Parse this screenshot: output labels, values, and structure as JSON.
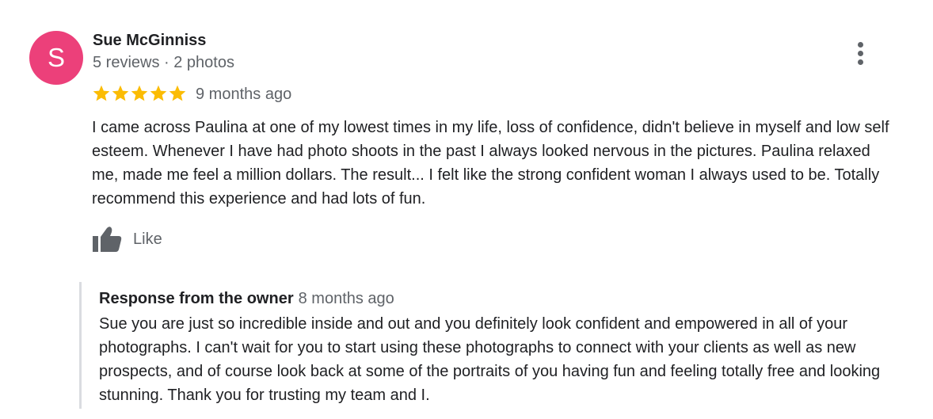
{
  "reviewer": {
    "initial": "S",
    "avatar_color": "#ec407a",
    "name": "Sue McGinniss",
    "meta": "5 reviews · 2 photos"
  },
  "rating": {
    "stars": 5,
    "max_stars": 5,
    "star_color": "#fbbc04",
    "date": "9 months ago"
  },
  "review": {
    "text": "I came across Paulina at one of my lowest times in my life, loss of confidence, didn't believe in myself and low self esteem. Whenever I have had photo shoots in the past I always looked nervous in the pictures. Paulina relaxed me, made me feel a million dollars. The result... I felt like the strong confident woman I always used to be. Totally recommend this experience and had lots of fun."
  },
  "actions": {
    "like_label": "Like",
    "like_icon": "thumbs-up-icon",
    "more_icon": "more-vertical-icon"
  },
  "owner_response": {
    "title": "Response from the owner",
    "date": "8 months ago",
    "text": "Sue you are just so incredible inside and out and you definitely look confident and empowered in all of your photographs. I can't wait for you to start using these photographs to connect with your clients as well as new prospects, and of course look back at some of the portraits of you having fun and feeling totally free and looking stunning. Thank you for trusting my team and I."
  }
}
